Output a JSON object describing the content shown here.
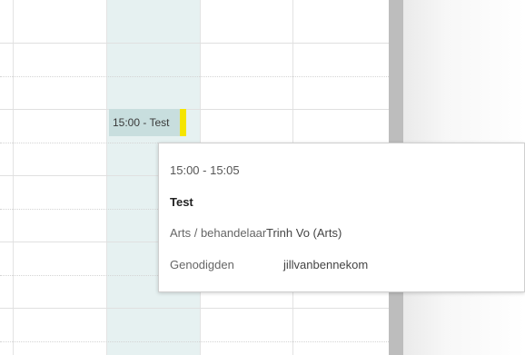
{
  "event": {
    "label": "15:00 - Test",
    "accent_color": "#f5e500"
  },
  "tooltip": {
    "time": "15:00 - 15:05",
    "title": "Test",
    "rows": [
      {
        "label": "Arts / behandelaar",
        "value": "Trinh Vo (Arts)"
      },
      {
        "label": "Genodigden",
        "value": "jillvanbennekom"
      }
    ]
  },
  "colors": {
    "today_column": "#e6f1f1",
    "event_bg": "#c8dede",
    "scrollbar": "#bdbdbd"
  }
}
